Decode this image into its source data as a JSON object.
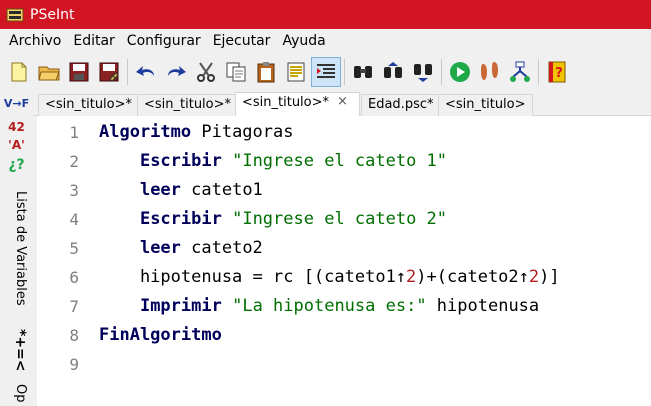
{
  "window": {
    "title": "PSeInt"
  },
  "menu": [
    {
      "id": "archivo",
      "label": "Archivo"
    },
    {
      "id": "editar",
      "label": "Editar"
    },
    {
      "id": "configurar",
      "label": "Configurar"
    },
    {
      "id": "ejecutar",
      "label": "Ejecutar"
    },
    {
      "id": "ayuda",
      "label": "Ayuda"
    }
  ],
  "toolbar": [
    "new-file-icon",
    "open-file-icon",
    "save-icon",
    "save-as-icon",
    "undo-icon",
    "redo-icon",
    "cut-icon",
    "copy-icon",
    "paste-icon",
    "comment-icon",
    "indent-icon",
    "find-icon",
    "find-previous-icon",
    "find-next-icon",
    "run-icon",
    "step-by-step-icon",
    "flowchart-icon",
    "help-icon"
  ],
  "side_panel": {
    "glyph1": "V→F",
    "glyph2": "42",
    "glyph3": "'A'",
    "glyph4": "¿?",
    "variables_label": "Lista de Variables",
    "operators_glyph": "*+=<",
    "operators_label": "Op"
  },
  "tabs": [
    {
      "label": "<sin_titulo>*",
      "active": false
    },
    {
      "label": "<sin_titulo>*",
      "active": false
    },
    {
      "label": "<sin_titulo>*",
      "active": true
    },
    {
      "label": "Edad.psc*",
      "active": false
    },
    {
      "label": "<sin_titulo>",
      "active": false
    }
  ],
  "tab_close_glyph": "×",
  "code_lines": [
    {
      "n": "1",
      "parts": [
        [
          "kw",
          "Algoritmo"
        ],
        [
          "txt",
          " Pitagoras"
        ]
      ]
    },
    {
      "n": "2",
      "parts": [
        [
          "txt",
          "    "
        ],
        [
          "kw",
          "Escribir"
        ],
        [
          "txt",
          " "
        ],
        [
          "str",
          "\"Ingrese el cateto 1\""
        ]
      ]
    },
    {
      "n": "3",
      "parts": [
        [
          "txt",
          "    "
        ],
        [
          "kw",
          "leer"
        ],
        [
          "txt",
          " cateto1"
        ]
      ]
    },
    {
      "n": "4",
      "parts": [
        [
          "txt",
          "    "
        ],
        [
          "kw",
          "Escribir"
        ],
        [
          "txt",
          " "
        ],
        [
          "str",
          "\"Ingrese el cateto 2\""
        ]
      ]
    },
    {
      "n": "5",
      "parts": [
        [
          "txt",
          "    "
        ],
        [
          "kw",
          "leer"
        ],
        [
          "txt",
          " cateto2"
        ]
      ]
    },
    {
      "n": "6",
      "parts": [
        [
          "txt",
          "    hipotenusa = rc [(cateto1↑"
        ],
        [
          "num",
          "2"
        ],
        [
          "txt",
          ")+(cateto2↑"
        ],
        [
          "num",
          "2"
        ],
        [
          "txt",
          ")]"
        ]
      ]
    },
    {
      "n": "7",
      "parts": [
        [
          "txt",
          "    "
        ],
        [
          "kw",
          "Imprimir"
        ],
        [
          "txt",
          " "
        ],
        [
          "str",
          "\"La hipotenusa es:\""
        ],
        [
          "txt",
          " hipotenusa"
        ]
      ]
    },
    {
      "n": "8",
      "parts": [
        [
          "kw",
          "FinAlgoritmo"
        ]
      ]
    },
    {
      "n": "9",
      "parts": []
    }
  ]
}
